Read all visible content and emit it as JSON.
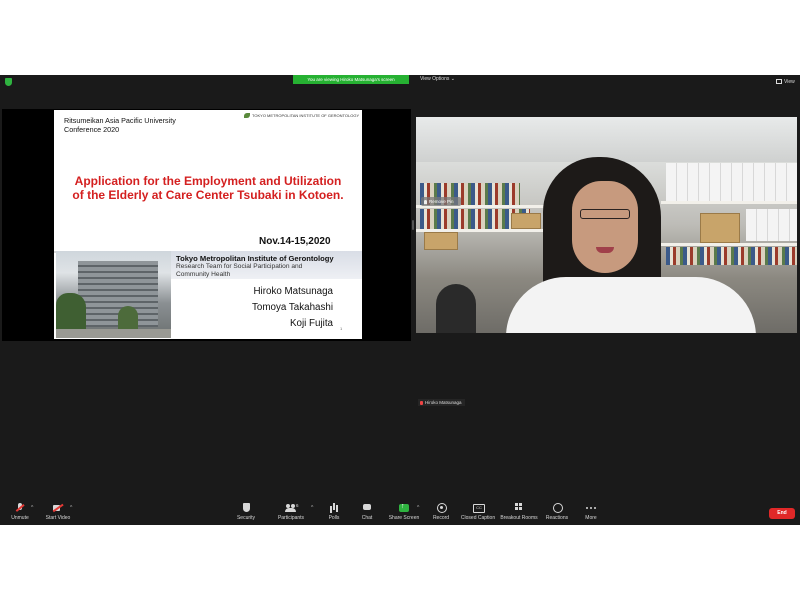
{
  "colors": {
    "banner_green": "#26b132",
    "end_red": "#e02828",
    "title_red": "#d42020",
    "window_bg": "#1a1a1a"
  },
  "topbar": {
    "banner": "You are viewing Hiroko Matsunaga's screen",
    "view_options": "View Options ⌄",
    "view": "View"
  },
  "slide": {
    "university": "Ritsumeikan Asia Pacific University",
    "conference": "Conference 2020",
    "logo_text": "TOKYO METROPOLITAN INSTITUTE OF GERONTOLOGY",
    "title_line1": "Application for the Employment and Utilization",
    "title_line2": "of the Elderly at Care Center Tsubaki in Kotoen.",
    "date": "Nov.14-15,2020",
    "institute": "Tokyo Metropolitan Institute of Gerontology",
    "team_line1": "Research Team for Social Participation and",
    "team_line2": "Community Health",
    "authors": [
      "Hiroko Matsunaga",
      "Tomoya Takahashi",
      "Koji Fujita"
    ],
    "page_number": "1"
  },
  "video": {
    "remove_pin": "Remove Pin",
    "participant_name": "Hiroko Matsunaga"
  },
  "toolbar": {
    "unmute": "Unmute",
    "start_video": "Start Video",
    "security": "Security",
    "participants": "Participants",
    "participants_count": "6",
    "polls": "Polls",
    "chat": "Chat",
    "share_screen": "Share Screen",
    "record": "Record",
    "closed_caption": "Closed Caption",
    "breakout_rooms": "Breakout Rooms",
    "reactions": "Reactions",
    "more": "More",
    "end": "End"
  }
}
